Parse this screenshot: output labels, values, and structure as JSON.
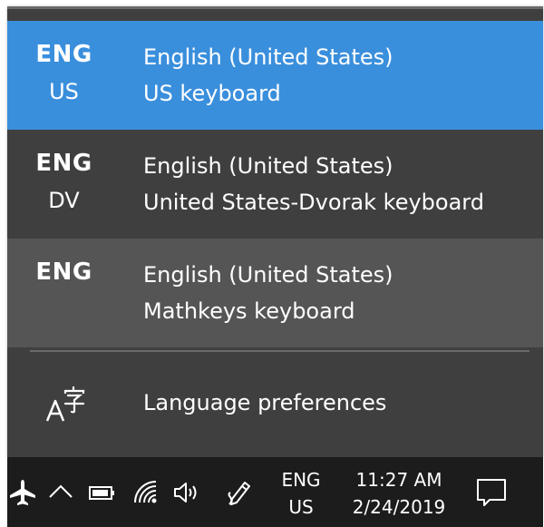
{
  "colors": {
    "flyout_bg": "#3f3f3f",
    "selected_bg": "#3a8fdc",
    "hover_bg": "#555555",
    "taskbar_bg": "#1c1c1c",
    "text": "#ffffff"
  },
  "input_menu": {
    "items": [
      {
        "lang": "ENG",
        "layout": "US",
        "language_name": "English (United States)",
        "keyboard_name": "US keyboard",
        "state": "selected"
      },
      {
        "lang": "ENG",
        "layout": "DV",
        "language_name": "English (United States)",
        "keyboard_name": "United States-Dvorak keyboard",
        "state": "normal"
      },
      {
        "lang": "ENG",
        "layout": "",
        "language_name": "English (United States)",
        "keyboard_name": "Mathkeys keyboard",
        "state": "hover"
      }
    ],
    "preferences_label": "Language preferences",
    "preferences_icon": "language-icon"
  },
  "taskbar": {
    "icons": [
      "airplane-mode-icon",
      "chevron-up-icon",
      "battery-icon",
      "wifi-icon",
      "volume-icon",
      "pen-icon",
      "notifications-icon"
    ],
    "lang": "ENG",
    "layout": "US",
    "time": "11:27 AM",
    "date": "2/24/2019"
  }
}
